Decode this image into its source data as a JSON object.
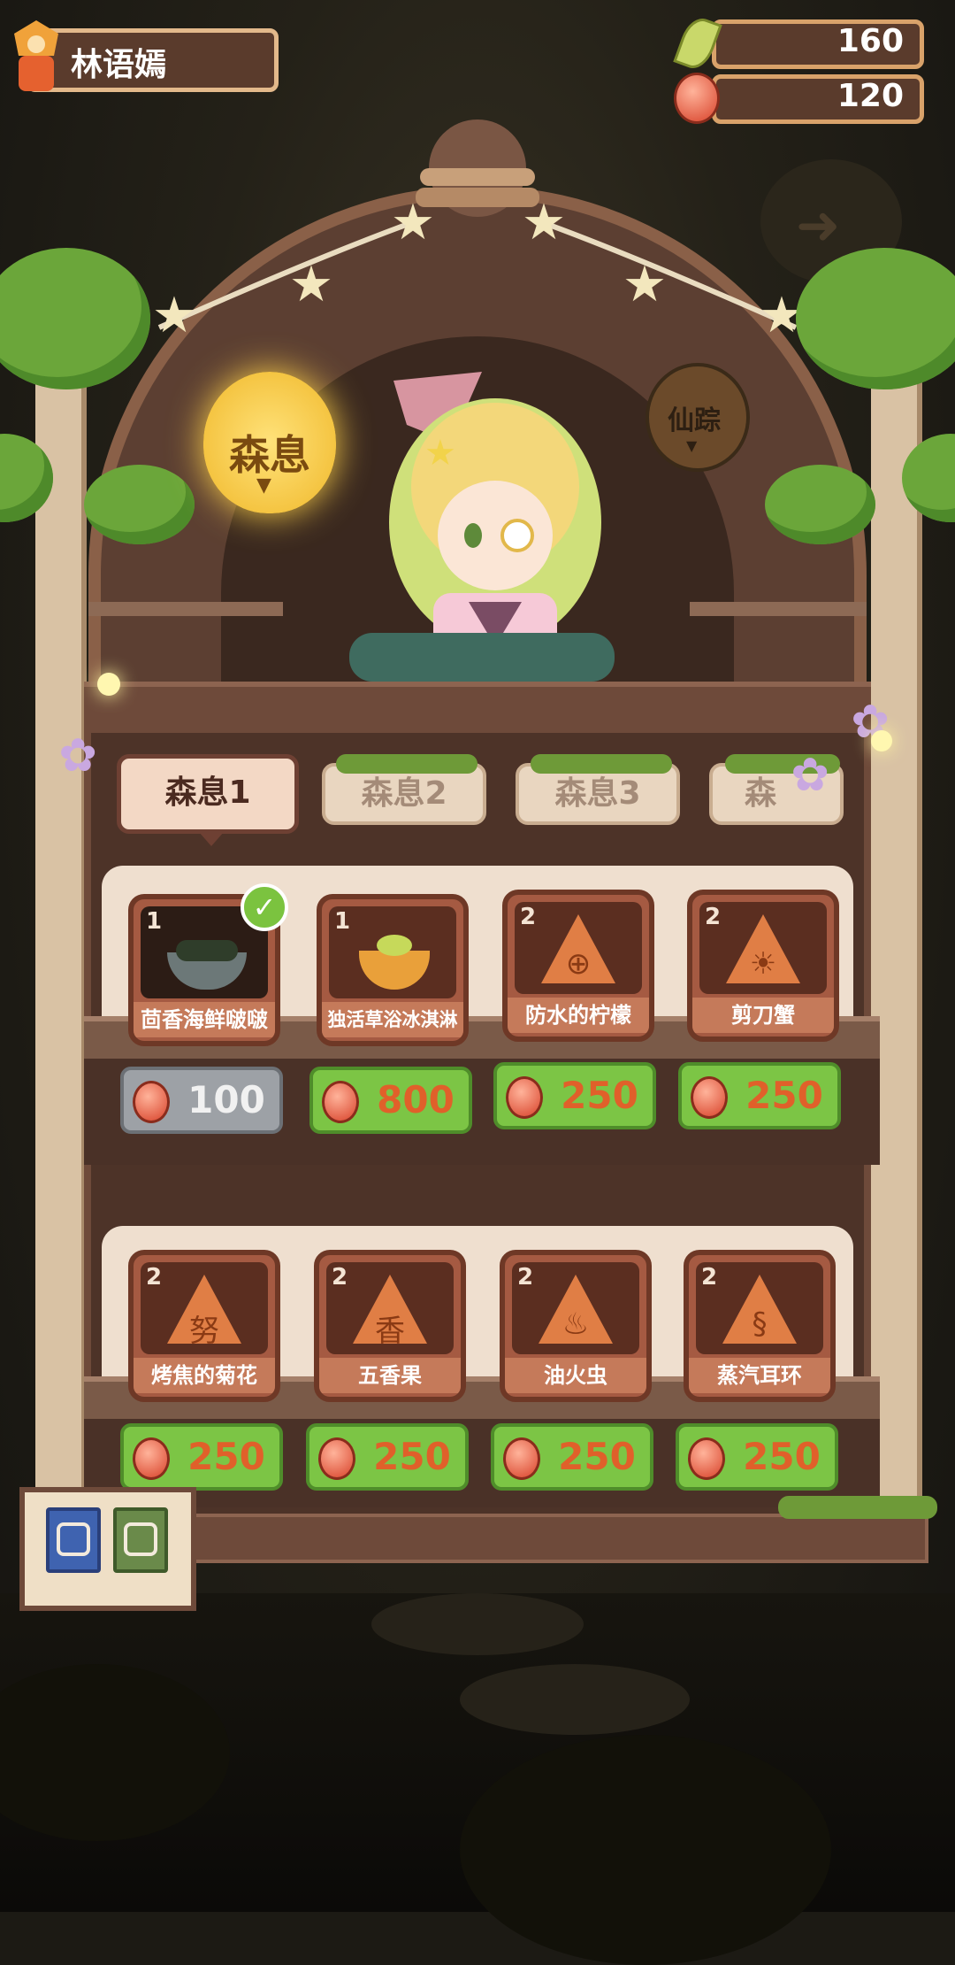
{
  "player": {
    "name": "林语嫣"
  },
  "resources": {
    "leaf": "160",
    "bean": "120"
  },
  "lanterns": {
    "active": "森息",
    "inactive": "仙踪"
  },
  "tabs": [
    {
      "label": "森息1",
      "active": true
    },
    {
      "label": "森息2",
      "active": false
    },
    {
      "label": "森息3",
      "active": false
    },
    {
      "label": "森",
      "active": false
    }
  ],
  "items": [
    {
      "count": "1",
      "name": "茴香海鲜啵啵",
      "price": "100",
      "owned": true,
      "glyph": ""
    },
    {
      "count": "1",
      "name": "独活草浴冰淇淋",
      "price": "800",
      "owned": false,
      "glyph": ""
    },
    {
      "count": "2",
      "name": "防水的柠檬",
      "price": "250",
      "owned": false,
      "glyph": "⊕"
    },
    {
      "count": "2",
      "name": "剪刀蟹",
      "price": "250",
      "owned": false,
      "glyph": "☀"
    },
    {
      "count": "2",
      "name": "烤焦的菊花",
      "price": "250",
      "owned": false,
      "glyph": "努"
    },
    {
      "count": "2",
      "name": "五香果",
      "price": "250",
      "owned": false,
      "glyph": "香"
    },
    {
      "count": "2",
      "name": "油火虫",
      "price": "250",
      "owned": false,
      "glyph": "♨"
    },
    {
      "count": "2",
      "name": "蒸汽耳环",
      "price": "250",
      "owned": false,
      "glyph": "§"
    }
  ],
  "colors": {
    "price_green": "#7cc545",
    "price_gray": "#9da1a6",
    "item_brown": "#a55a42"
  },
  "icons": {
    "leaf": "leaf-icon",
    "bean": "bean-icon",
    "check": "check-icon"
  }
}
